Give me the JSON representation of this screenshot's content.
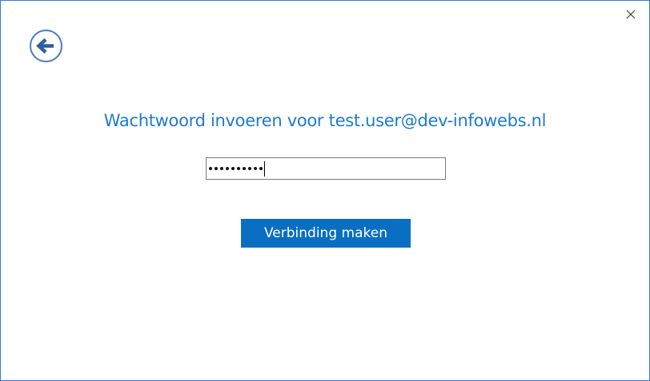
{
  "dialog": {
    "title": "Wachtwoord invoeren voor test.user@dev-infowebs.nl",
    "password_masked": "••••••••••",
    "password_length": 10,
    "connect_button_label": "Verbinding maken"
  },
  "icons": {
    "back": "back-arrow-icon",
    "close": "close-icon"
  },
  "colors": {
    "accent": "#1f7acb",
    "button": "#0a6fc2",
    "border": "#2b7fd4"
  }
}
